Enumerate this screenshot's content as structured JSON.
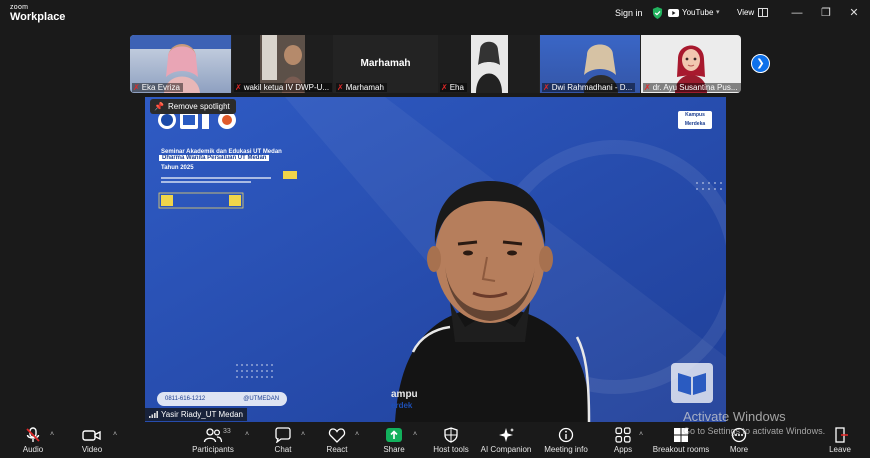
{
  "app": {
    "brand_small": "zoom",
    "brand_large": "Workplace"
  },
  "titlebar": {
    "sign_in": "Sign in",
    "youtube_label": "YouTube",
    "view_label": "View",
    "icons": [
      "shield-check-icon",
      "youtube-icon",
      "minimize-icon",
      "restore-icon",
      "close-icon"
    ]
  },
  "filmstrip": {
    "tiles": [
      {
        "name": "Eka Evriza",
        "muted": true
      },
      {
        "name": "wakil ketua IV DWP-U...",
        "muted": true
      },
      {
        "name": "Marhamah",
        "title": "Marhamah",
        "muted": true
      },
      {
        "name": "Eha",
        "muted": true
      },
      {
        "name": "Dwi Rahmadhani - D...",
        "muted": true
      },
      {
        "name": "dr. Ayu Susantina Pus...",
        "muted": true
      }
    ],
    "next_icon": "chevron-right-icon"
  },
  "main_video": {
    "spotlight_label": "Remove spotlight",
    "participant_name": "Yasir Riady_UT Medan",
    "slide": {
      "title_1": "Seminar Akademik dan Edukasi UT Medan",
      "title_2": "Dharma Wanita Persatuan UT Medan",
      "title_3": "Tahun 2025",
      "brand": "Kampus Merdeka",
      "contact_phone": "0811-616-1212",
      "contact_handle": "@UTMEDAN"
    }
  },
  "watermark": {
    "line1": "Activate Windows",
    "line2": "Go to Settings to activate Windows."
  },
  "toolbar": {
    "audio": "Audio",
    "video": "Video",
    "participants": "Participants",
    "participants_count": "33",
    "chat": "Chat",
    "react": "React",
    "share": "Share",
    "host_tools": "Host tools",
    "ai_companion": "AI Companion",
    "meeting_info": "Meeting info",
    "apps": "Apps",
    "breakout_rooms": "Breakout rooms",
    "more": "More",
    "leave": "Leave"
  },
  "colors": {
    "accent": "#0e71eb",
    "share": "#12b05c",
    "muted": "#e02828",
    "slide_bg": "#2a4fb0"
  }
}
